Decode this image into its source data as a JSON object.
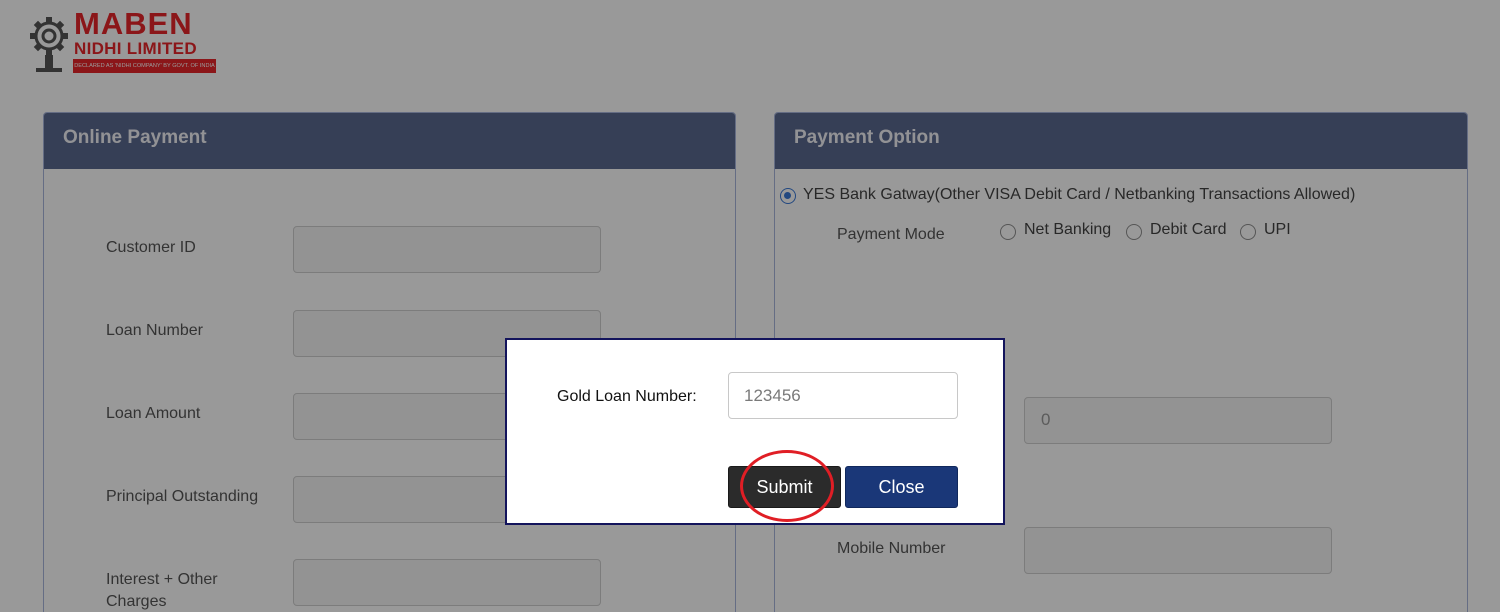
{
  "logo": {
    "line1": "MABEN",
    "line2": "NIDHI LIMITED",
    "tagline": "DECLARED AS 'NIDHI COMPANY' BY GOVT. OF INDIA",
    "brand_color": "#e8262b"
  },
  "online_payment": {
    "title": "Online Payment",
    "fields": [
      {
        "label": "Customer ID",
        "value": ""
      },
      {
        "label": "Loan Number",
        "value": ""
      },
      {
        "label": "Loan Amount",
        "value": ""
      },
      {
        "label": "Principal Outstanding",
        "value": ""
      },
      {
        "label": "Interest + Other Charges",
        "value": ""
      }
    ]
  },
  "payment_option": {
    "title": "Payment Option",
    "gateway_label": "YES Bank Gatway(Other VISA Debit Card / Netbanking Transactions Allowed)",
    "payment_mode_label": "Payment Mode",
    "modes": [
      "Net Banking",
      "Debit Card",
      "UPI"
    ],
    "amount_value": "0",
    "mobile_label": "Mobile Number",
    "mobile_value": ""
  },
  "modal": {
    "label": "Gold Loan Number:",
    "input_value": "123456",
    "submit_label": "Submit",
    "close_label": "Close",
    "highlight_color": "#e01e25"
  },
  "colors": {
    "panel_header": "#5b6a8f",
    "modal_border": "#13145c",
    "submit_button": "#2b2b2b",
    "close_button": "#1a3778"
  }
}
